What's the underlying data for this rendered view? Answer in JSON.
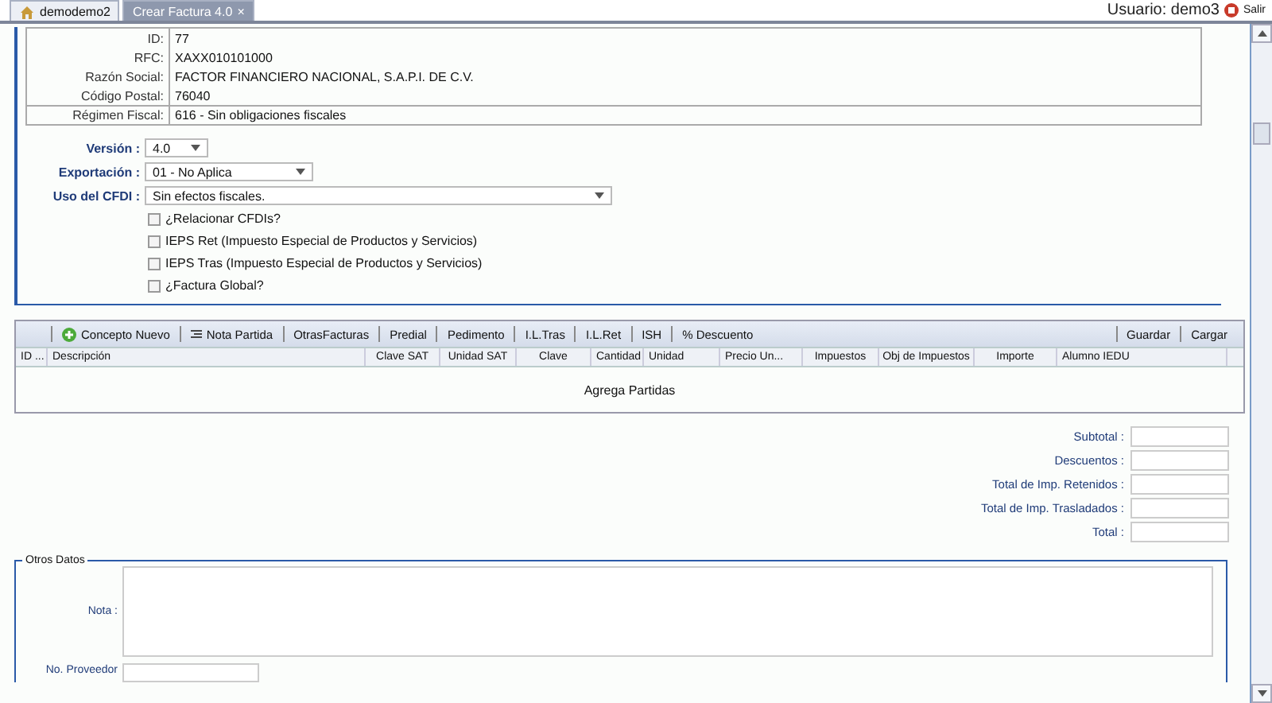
{
  "tabs": [
    {
      "label": "demodemo2",
      "kind": "home",
      "selected": false
    },
    {
      "label": "Crear Factura 4.0",
      "kind": "closable",
      "close": "×",
      "selected": true
    }
  ],
  "user": {
    "label": "Usuario: demo3",
    "logout": "Salir"
  },
  "client": {
    "rows": [
      {
        "label": "ID:",
        "value": "77"
      },
      {
        "label": "RFC:",
        "value": "XAXX010101000"
      },
      {
        "label": "Razón Social:",
        "value": "FACTOR FINANCIERO NACIONAL, S.A.P.I. DE C.V."
      },
      {
        "label": "Código Postal:",
        "value": "76040"
      }
    ],
    "regimen": {
      "label": "Régimen Fiscal:",
      "value": "616 - Sin obligaciones fiscales"
    }
  },
  "selects": [
    {
      "label": "Versión :",
      "value": "4.0"
    },
    {
      "label": "Exportación :",
      "value": "01 - No Aplica"
    },
    {
      "label": "Uso del CFDI :",
      "value": "Sin efectos fiscales."
    }
  ],
  "checkboxes": [
    {
      "label": "¿Relacionar CFDIs?",
      "checked": false
    },
    {
      "label": "IEPS Ret (Impuesto Especial de Productos y Servicios)",
      "checked": false
    },
    {
      "label": "IEPS Tras (Impuesto Especial de Productos y Servicios)",
      "checked": false
    },
    {
      "label": "¿Factura Global?",
      "checked": false
    }
  ],
  "toolbar": {
    "left": [
      {
        "label": "Concepto Nuevo",
        "kind": "add"
      },
      {
        "label": "Nota Partida",
        "kind": "note"
      },
      {
        "label": "OtrasFacturas",
        "kind": "plain"
      },
      {
        "label": "Predial",
        "kind": "plain"
      },
      {
        "label": "Pedimento",
        "kind": "plain"
      },
      {
        "label": "I.L.Tras",
        "kind": "plain"
      },
      {
        "label": "I.L.Ret",
        "kind": "plain"
      },
      {
        "label": "ISH",
        "kind": "plain"
      },
      {
        "label": "% Descuento",
        "kind": "plain"
      }
    ],
    "right": [
      "Guardar",
      "Cargar"
    ]
  },
  "table": {
    "columns": [
      "ID ...",
      "Descripción",
      "Clave SAT",
      "Unidad SAT",
      "Clave",
      "Cantidad",
      "Unidad",
      "Precio Un...",
      "Impuestos",
      "Obj de Impuestos",
      "Importe",
      "Alumno IEDU"
    ],
    "empty": "Agrega Partidas"
  },
  "totals": [
    "Subtotal :",
    "Descuentos :",
    "Total de Imp. Retenidos :",
    "Total de Imp. Trasladados :",
    "Total :"
  ],
  "otros": {
    "title": "Otros Datos",
    "nota": "Nota :",
    "proveedor": "No. Proveedor"
  }
}
